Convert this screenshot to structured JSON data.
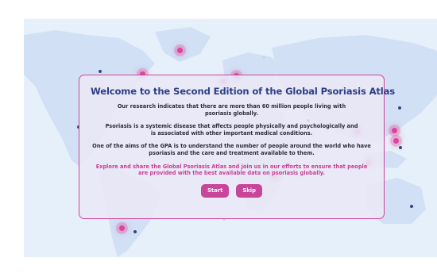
{
  "modal": {
    "title": "Welcome to the Second Edition of the Global Psoriasis Atlas",
    "paragraph1": "Our research indicates that there are more than 60 million people living with psoriasis globally.",
    "paragraph2": "Psoriasis is a systemic disease that affects people physically and psychologically and is associated with other important medical conditions.",
    "paragraph3": "One of the aims of the GPA is to understand the number of people around the world who have psoriasis and the care and treatment available to them.",
    "highlight": "Explore and share the Global Psoriasis Atlas and join us in our efforts to ensure that people are provided with the best available data on psoriasis globally.",
    "start_label": "Start",
    "skip_label": "Skip"
  },
  "colors": {
    "map_background": "#e6f0fa",
    "land": "#d1e0f4",
    "title": "#2e3f86",
    "accent": "#cc3d96",
    "button": "#c8459a",
    "modal_border": "#d2449a"
  },
  "icons": {
    "map": "world-map-illustration",
    "markers": "country-marker-dot"
  }
}
